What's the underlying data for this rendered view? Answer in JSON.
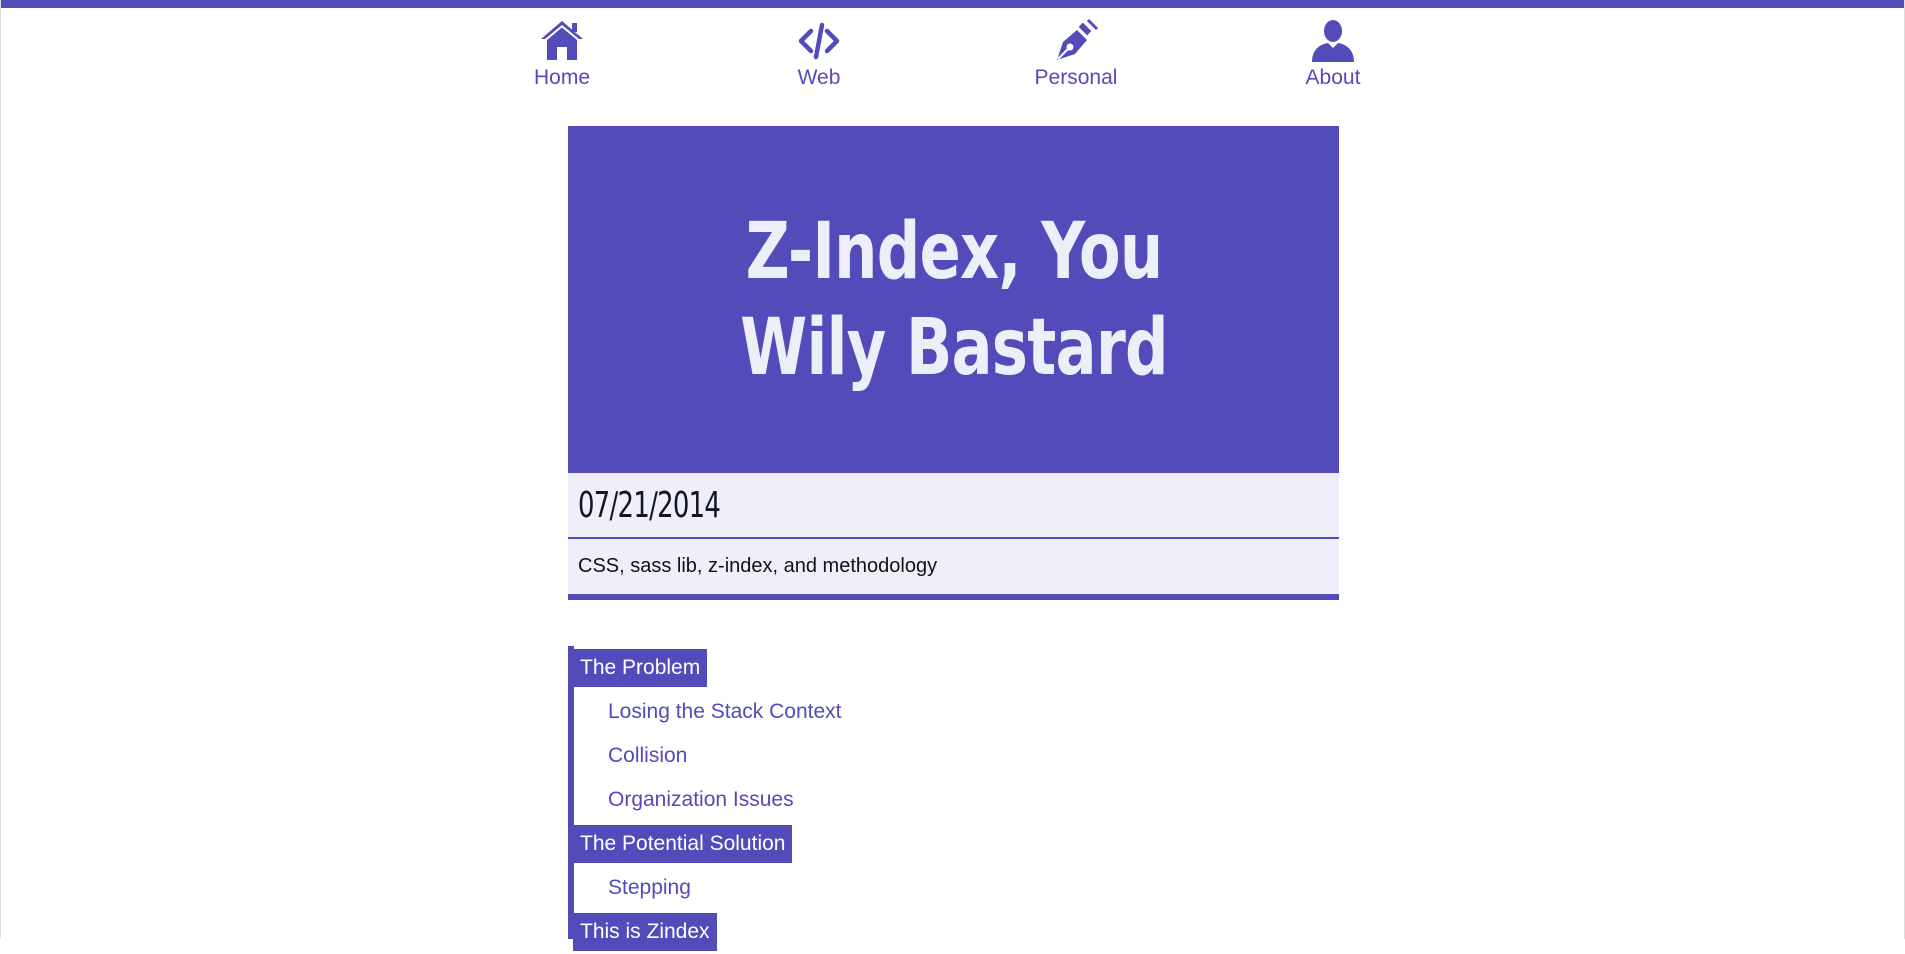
{
  "nav": {
    "items": [
      {
        "label": "Home",
        "icon": "home-icon"
      },
      {
        "label": "Web",
        "icon": "code-icon"
      },
      {
        "label": "Personal",
        "icon": "pen-nib-icon"
      },
      {
        "label": "About",
        "icon": "user-icon"
      }
    ]
  },
  "post": {
    "title": "Z-Index, You Wily Bastard",
    "date": "07/21/2014",
    "tags": "CSS, sass lib, z-index, and methodology"
  },
  "toc": {
    "sections": [
      {
        "label": "The Problem",
        "children": [
          "Losing the Stack Context",
          "Collision",
          "Organization Issues"
        ]
      },
      {
        "label": "The Potential Solution",
        "children": [
          "Stepping"
        ]
      },
      {
        "label": "This is Zindex",
        "children": []
      }
    ]
  },
  "colors": {
    "accent": "#524bb9",
    "hero_text": "#eceef8",
    "meta_background": "#eeeff9"
  }
}
